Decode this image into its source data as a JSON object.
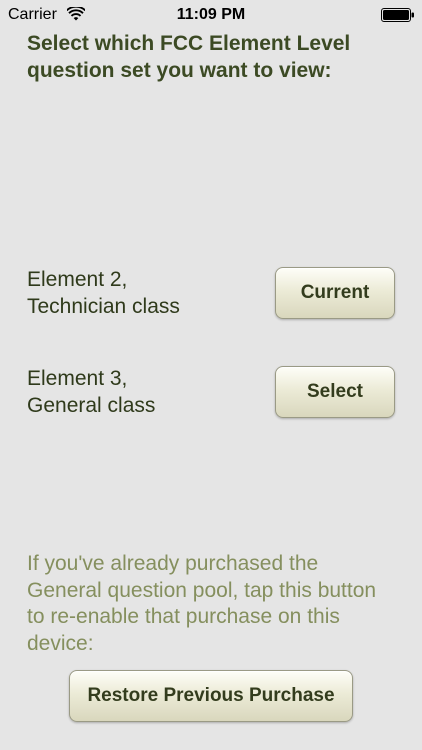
{
  "status_bar": {
    "carrier": "Carrier",
    "time": "11:09 PM",
    "wifi_icon": "wifi-icon",
    "battery_icon": "battery-icon"
  },
  "heading": "Select which FCC Element Level question set you want to view:",
  "elements": [
    {
      "label": "Element 2,\nTechnician class",
      "button_label": "Current"
    },
    {
      "label": "Element 3,\nGeneral class",
      "button_label": "Select"
    }
  ],
  "restore": {
    "info_text": "If you've already purchased the General question pool, tap this button to re-enable that purchase on this device:",
    "button_label": "Restore Previous Purchase"
  },
  "colors": {
    "background": "#e5e5e5",
    "heading": "#3c4a24",
    "label": "#2f3a1b",
    "info_text": "#858f5e",
    "button_text": "#333c1d"
  }
}
